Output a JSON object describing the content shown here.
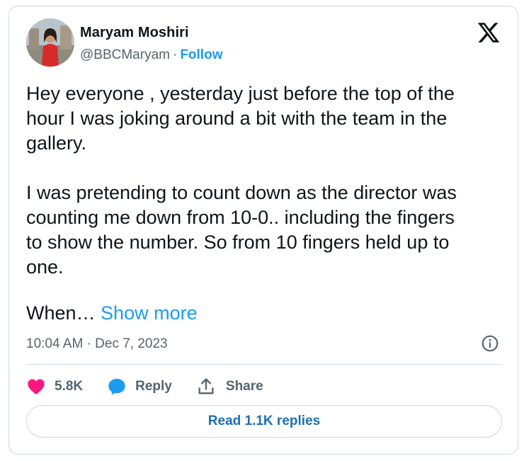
{
  "author": {
    "name": "Maryam Moshiri",
    "handle": "@BBCMaryam",
    "separator": "·",
    "follow_label": "Follow"
  },
  "tweet": {
    "text": "Hey everyone , yesterday just before the top of the\nhour I was joking around a bit with the team in the\ngallery.\n\nI was pretending to count down as the director was\ncounting me down from 10-0.. including the fingers\nto show the number. So from 10 fingers held up to\none.",
    "truncated_text": "When… ",
    "show_more_label": "Show more",
    "timestamp": "10:04 AM · Dec 7, 2023"
  },
  "actions": {
    "like_count": "5.8K",
    "reply_label": "Reply",
    "share_label": "Share"
  },
  "read_replies_label": "Read 1.1K replies",
  "icons": {
    "logo": "x-logo-icon",
    "info": "info-icon",
    "like": "heart-icon",
    "reply": "speech-bubble-icon",
    "share": "share-upload-icon"
  },
  "colors": {
    "accent": "#1d9bf0",
    "heart": "#f91880",
    "muted": "#536471",
    "border": "#cfd9de"
  }
}
